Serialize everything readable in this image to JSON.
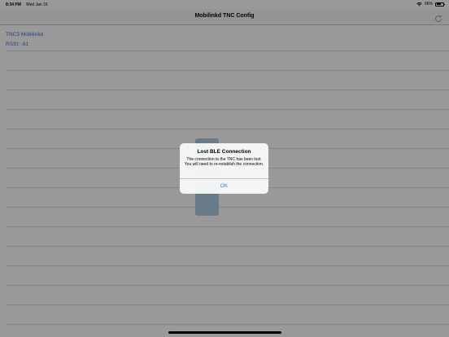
{
  "status_bar": {
    "time": "8:34 PM",
    "date": "Wed Jan 16",
    "battery_percent_text": "66%",
    "battery_level": 0.66,
    "wifi_icon": "wifi-icon",
    "battery_icon": "battery-icon"
  },
  "nav": {
    "title": "Mobilinkd TNC Config",
    "refresh_icon": "refresh-icon"
  },
  "device": {
    "name": "TNC3 Mobilinkd",
    "rssi": "RSSI: -61"
  },
  "alert": {
    "title": "Lost BLE Connection",
    "message": "The connection to the TNC has been lost.  You will need to re-establish the connection.",
    "ok_label": "OK"
  },
  "colors": {
    "accent": "#3478f6",
    "link": "#3c6fd6",
    "graphic": "#a9cbe3"
  }
}
